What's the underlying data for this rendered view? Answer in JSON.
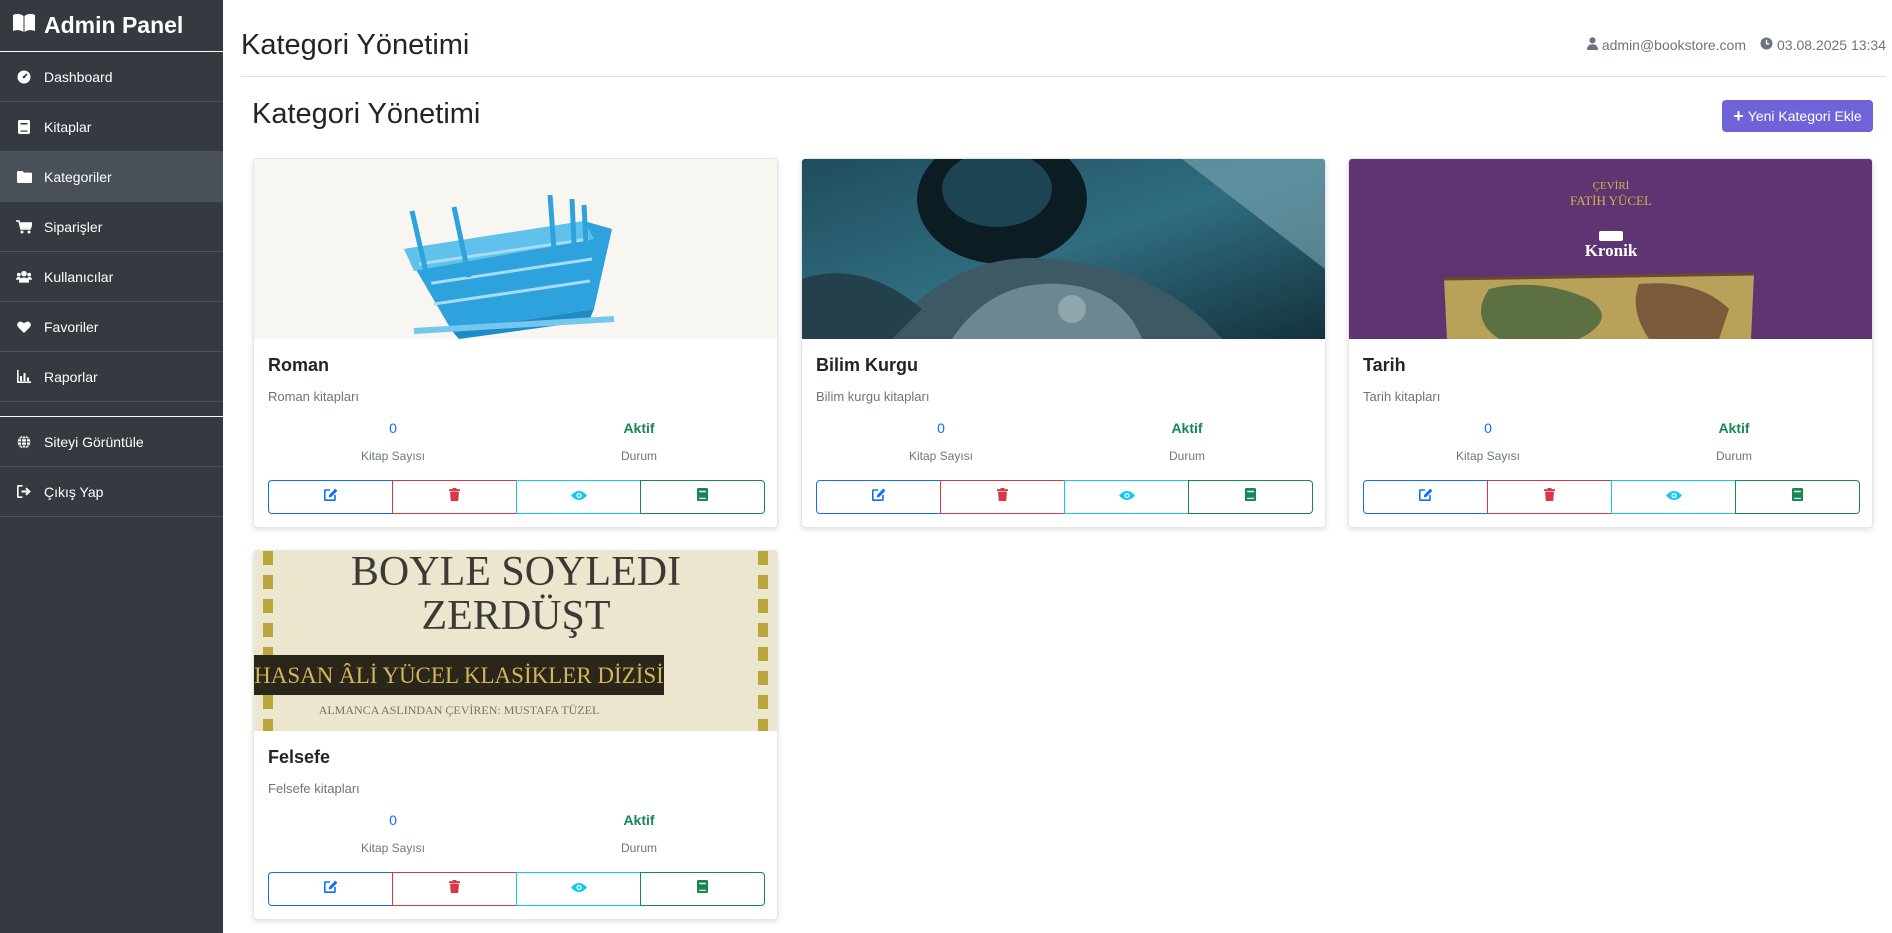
{
  "sidebar": {
    "brand": "Admin Panel",
    "items": [
      {
        "label": "Dashboard",
        "icon": "tachometer-icon"
      },
      {
        "label": "Kitaplar",
        "icon": "book-icon"
      },
      {
        "label": "Kategoriler",
        "icon": "folder-icon",
        "active": true
      },
      {
        "label": "Siparişler",
        "icon": "cart-icon"
      },
      {
        "label": "Kullanıcılar",
        "icon": "users-icon"
      },
      {
        "label": "Favoriler",
        "icon": "heart-icon"
      },
      {
        "label": "Raporlar",
        "icon": "chart-icon"
      }
    ],
    "bottom_items": [
      {
        "label": "Siteyi Görüntüle",
        "icon": "globe-icon"
      },
      {
        "label": "Çıkış Yap",
        "icon": "sign-out-icon"
      }
    ]
  },
  "header": {
    "title": "Kategori Yönetimi",
    "user": "admin@bookstore.com",
    "datetime": "03.08.2025 13:34"
  },
  "main": {
    "title": "Kategori Yönetimi",
    "add_button": "Yeni Kategori Ekle"
  },
  "categories": [
    {
      "name": "Roman",
      "description": "Roman kitapları",
      "book_count": "0",
      "book_count_label": "Kitap Sayısı",
      "status": "Aktif",
      "status_label": "Durum"
    },
    {
      "name": "Bilim Kurgu",
      "description": "Bilim kurgu kitapları",
      "book_count": "0",
      "book_count_label": "Kitap Sayısı",
      "status": "Aktif",
      "status_label": "Durum"
    },
    {
      "name": "Tarih",
      "description": "Tarih kitapları",
      "book_count": "0",
      "book_count_label": "Kitap Sayısı",
      "status": "Aktif",
      "status_label": "Durum"
    },
    {
      "name": "Felsefe",
      "description": "Felsefe kitapları",
      "book_count": "0",
      "book_count_label": "Kitap Sayısı",
      "status": "Aktif",
      "status_label": "Durum"
    }
  ],
  "cover_texts": {
    "tarih_line1": "ÇEVİRİ",
    "tarih_line2": "FATİH YÜCEL",
    "tarih_publisher": "Kronik",
    "felsefe_title1": "BOYLE SOYLEDI",
    "felsefe_title2": "ZERDÜŞT",
    "felsefe_series": "HASAN ÂLİ YÜCEL KLASİKLER DİZİSİ",
    "felsefe_translator": "ALMANCA ASLINDAN ÇEVİREN: MUSTAFA TÜZEL"
  },
  "colors": {
    "sidebar_bg": "#343a40",
    "accent": "#6f63d9",
    "primary": "#0d6efd",
    "success": "#198754",
    "danger": "#dc3545",
    "info": "#0dcaf0"
  }
}
